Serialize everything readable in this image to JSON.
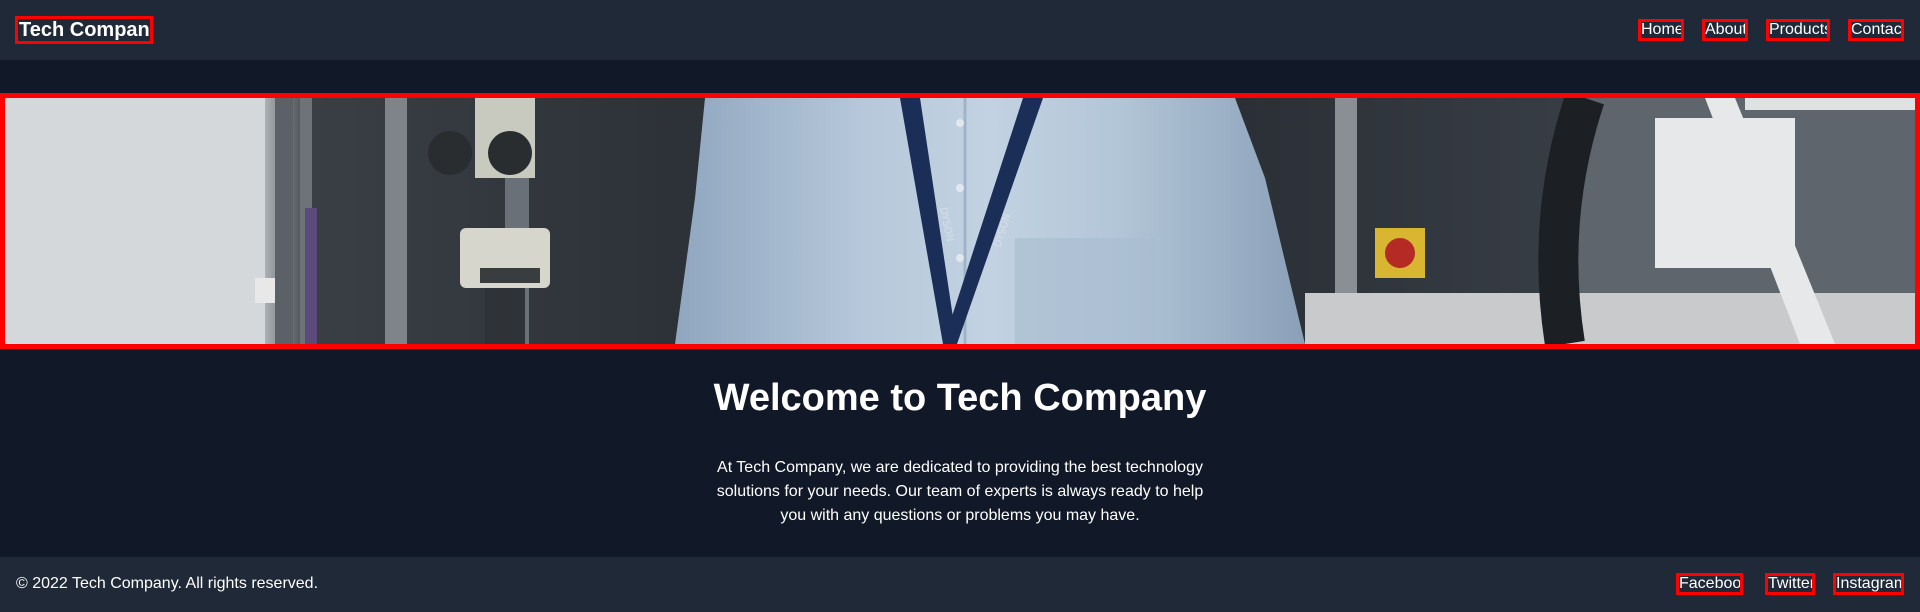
{
  "header": {
    "brand": "Tech Company",
    "nav": [
      {
        "label": "Home"
      },
      {
        "label": "About"
      },
      {
        "label": "Products"
      },
      {
        "label": "Contact"
      }
    ]
  },
  "hero": {
    "lanyard_text": "DYSON"
  },
  "main": {
    "headline": "Welcome to Tech Company",
    "intro": "At Tech Company, we are dedicated to providing the best technology solutions for your needs. Our team of experts is always ready to help you with any questions or problems you may have."
  },
  "footer": {
    "copyright": "© 2022 Tech Company. All rights reserved.",
    "social": [
      {
        "label": "Facebook"
      },
      {
        "label": "Twitter"
      },
      {
        "label": "Instagram"
      }
    ]
  }
}
